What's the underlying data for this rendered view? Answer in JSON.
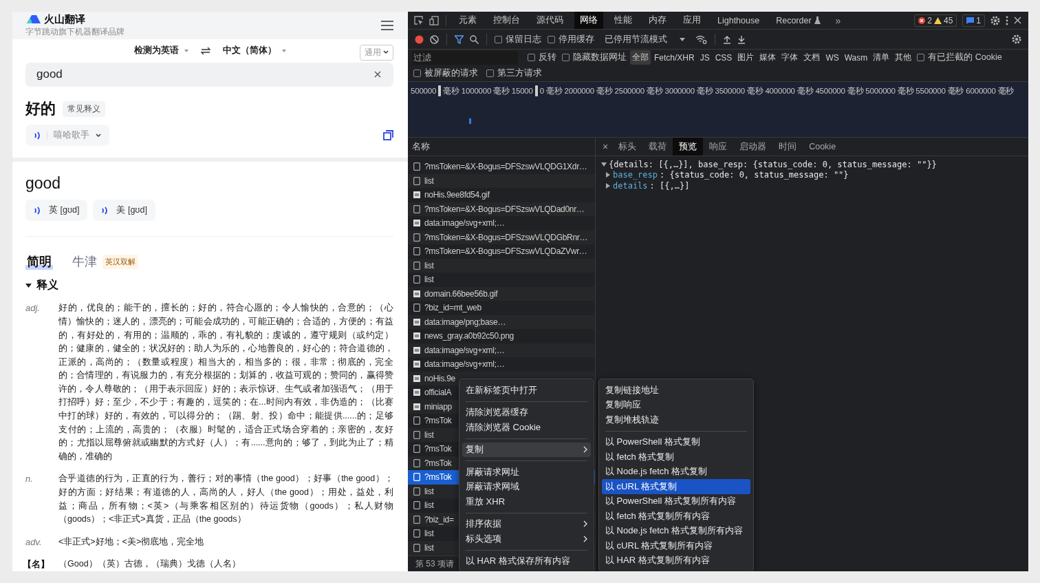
{
  "translator": {
    "logo_title": "火山翻译",
    "tagline": "字节跳动旗下机器翻译品牌",
    "source_lang": "检测为英语",
    "target_lang": "中文（简体）",
    "domain": "通用",
    "input_value": "good",
    "main_translation": "好的",
    "translation_tag": "常见释义",
    "voice": "嘻哈歌手",
    "word": "good",
    "pronunciations": [
      {
        "label": "英 [gʊd]"
      },
      {
        "label": "美 [gʊd]"
      }
    ],
    "dict_tabs": [
      {
        "label": "简明",
        "selected": true
      },
      {
        "label": "牛津",
        "selected": false,
        "badge": "英汉双解"
      }
    ],
    "section": {
      "title": "释义",
      "expanded": true
    },
    "definitions": [
      {
        "pos": "adj.",
        "kind": "pos",
        "text": "好的，优良的；能干的，擅长的；好的，符合心愿的；令人愉快的，合意的；（心情）愉快的；迷人的，漂亮的；可能会成功的，可能正确的；合适的，方便的；有益的，有好处的，有用的；温顺的，乖的，有礼貌的；虔诚的，遵守规则（或约定）的；健康的，健全的；状况好的；助人为乐的，心地善良的，好心的；符合道德的，正派的，高尚的；（数量或程度）相当大的，相当多的；很，非常；彻底的，完全的；合情理的，有说服力的，有充分根据的；划算的，收益可观的；赞同的，赢得赞许的，令人尊敬的；（用于表示回应）好的；表示惊讶、生气或者加强语气；（用于打招呼）好；至少，不少于；有趣的，逗笑的；在...时间内有效，非伪造的；（比赛中打的球）好的，有效的，可以得分的；（踢、射、投）命中；能提供......的；足够支付的；上流的，高贵的；（衣服）时髦的，适合正式场合穿着的；亲密的，友好的；尤指以屈尊俯就或幽默的方式好（人）；有......意向的；够了，到此为止了；精确的，准确的"
      },
      {
        "pos": "n.",
        "kind": "pos",
        "text": "合乎道德的行为，正直的行为，善行；对的事情（the good）；好事（the good）；好的方面；好结果；有道德的人，高尚的人，好人（the good）；用处，益处，利益；商品，所有物；<英>（与乘客相区别的）待运货物（goods）；私人财物（goods）；<非正式>真货，正品（the goods）"
      },
      {
        "pos": "adv.",
        "kind": "pos",
        "text": "<非正式>好地；<美>彻底地，完全地"
      },
      {
        "pos": "【名】",
        "kind": "name",
        "text": "（Good）（英）古德，（瑞典）戈德（人名）"
      }
    ]
  },
  "devtools": {
    "panel_tabs": [
      {
        "label": "元素",
        "selected": false,
        "kind": "plain"
      },
      {
        "label": "控制台",
        "selected": false,
        "kind": "plain"
      },
      {
        "label": "源代码",
        "selected": false,
        "kind": "plain"
      },
      {
        "label": "网络",
        "selected": true,
        "kind": "plain"
      },
      {
        "label": "性能",
        "selected": false,
        "kind": "plain"
      },
      {
        "label": "内存",
        "selected": false,
        "kind": "plain"
      },
      {
        "label": "应用",
        "selected": false,
        "kind": "plain"
      },
      {
        "label": "Lighthouse",
        "selected": false,
        "kind": "plain"
      },
      {
        "label": "Recorder",
        "selected": false,
        "kind": "experimental"
      }
    ],
    "more_tabs": "»",
    "errors": "2",
    "warnings": "45",
    "messages": "1",
    "toolbar": {
      "recording": true,
      "checkboxes": [
        {
          "label": "保留日志",
          "checked": false
        },
        {
          "label": "停用缓存",
          "checked": false
        }
      ],
      "throttling": "已停用节流模式"
    },
    "filter": {
      "placeholder": "过滤",
      "options": [
        {
          "label": "反转",
          "checked": false
        },
        {
          "label": "隐藏数据网址",
          "checked": false
        }
      ],
      "types": [
        {
          "label": "全部",
          "selected": true
        },
        {
          "label": "Fetch/XHR",
          "selected": false
        },
        {
          "label": "JS",
          "selected": false
        },
        {
          "label": "CSS",
          "selected": false
        },
        {
          "label": "图片",
          "selected": false
        },
        {
          "label": "媒体",
          "selected": false
        },
        {
          "label": "字体",
          "selected": false
        },
        {
          "label": "文档",
          "selected": false
        },
        {
          "label": "WS",
          "selected": false
        },
        {
          "label": "Wasm",
          "selected": false
        },
        {
          "label": "清单",
          "selected": false
        },
        {
          "label": "其他",
          "selected": false
        }
      ],
      "cookie_option": {
        "label": "有已拦截的 Cookie",
        "checked": false
      },
      "more_options": [
        {
          "label": "被屏蔽的请求",
          "checked": false
        },
        {
          "label": "第三方请求",
          "checked": false
        }
      ]
    },
    "overview": {
      "ticks": [
        {
          "text": "500000",
          "handle_after": true
        },
        {
          "text": "毫秒",
          "handle_after": false
        },
        {
          "text": "1000000 毫秒",
          "handle_after": false
        },
        {
          "text": "15000",
          "handle_after": true
        },
        {
          "text": "0 毫秒",
          "handle_after": false
        },
        {
          "text": "2000000 毫秒",
          "handle_after": false
        },
        {
          "text": "2500000 毫秒",
          "handle_after": false
        },
        {
          "text": "3000000 毫秒",
          "handle_after": false
        },
        {
          "text": "3500000 毫秒",
          "handle_after": false
        },
        {
          "text": "4000000 毫秒",
          "handle_after": false
        },
        {
          "text": "4500000 毫秒",
          "handle_after": false
        },
        {
          "text": "5000000 毫秒",
          "handle_after": false
        },
        {
          "text": "5500000 毫秒",
          "handle_after": false
        },
        {
          "text": "6000000 毫秒",
          "handle_after": false
        }
      ]
    },
    "requests": {
      "header": "名称",
      "status": "第 53 项请",
      "rows": [
        {
          "name": "?msToken=&X-Bogus=DFSzswVLQDG1Xdr…",
          "kind": "xhr",
          "selected": false
        },
        {
          "name": "list",
          "kind": "xhr",
          "selected": false
        },
        {
          "name": "noHis.9ee8fd54.gif",
          "kind": "image",
          "selected": false
        },
        {
          "name": "?msToken=&X-Bogus=DFSzswVLQDad0nr…",
          "kind": "xhr",
          "selected": false
        },
        {
          "name": "data:image/svg+xml;…",
          "kind": "image",
          "selected": false
        },
        {
          "name": "?msToken=&X-Bogus=DFSzswVLQDGbRnr…",
          "kind": "xhr",
          "selected": false
        },
        {
          "name": "?msToken=&X-Bogus=DFSzswVLQDaZVwr…",
          "kind": "xhr",
          "selected": false
        },
        {
          "name": "list",
          "kind": "xhr",
          "selected": false
        },
        {
          "name": "list",
          "kind": "xhr",
          "selected": false
        },
        {
          "name": "domain.66bee56b.gif",
          "kind": "image",
          "selected": false
        },
        {
          "name": "?biz_id=mt_web",
          "kind": "xhr",
          "selected": false
        },
        {
          "name": "data:image/png;base…",
          "kind": "image",
          "selected": false
        },
        {
          "name": "news_gray.a0b92c50.png",
          "kind": "image",
          "selected": false
        },
        {
          "name": "data:image/svg+xml;…",
          "kind": "image",
          "selected": false
        },
        {
          "name": "data:image/svg+xml;…",
          "kind": "image",
          "selected": false
        },
        {
          "name": "noHis.9e",
          "kind": "image",
          "selected": false
        },
        {
          "name": "officialA",
          "kind": "image",
          "selected": false
        },
        {
          "name": "miniapp",
          "kind": "image",
          "selected": false
        },
        {
          "name": "?msTok",
          "kind": "xhr",
          "selected": false
        },
        {
          "name": "list",
          "kind": "xhr",
          "selected": false
        },
        {
          "name": "?msTok",
          "kind": "xhr",
          "selected": false
        },
        {
          "name": "?msTok",
          "kind": "xhr",
          "selected": false
        },
        {
          "name": "?msTok",
          "kind": "xhr",
          "selected": true
        },
        {
          "name": "list",
          "kind": "xhr",
          "selected": false
        },
        {
          "name": "list",
          "kind": "xhr",
          "selected": false
        },
        {
          "name": "?biz_id=",
          "kind": "xhr",
          "selected": false
        },
        {
          "name": "list",
          "kind": "xhr",
          "selected": false
        },
        {
          "name": "list",
          "kind": "xhr",
          "selected": false
        }
      ]
    },
    "detail": {
      "close": "×",
      "tabs": [
        {
          "label": "标头",
          "selected": false
        },
        {
          "label": "载荷",
          "selected": false
        },
        {
          "label": "预览",
          "selected": true
        },
        {
          "label": "响应",
          "selected": false
        },
        {
          "label": "启动器",
          "selected": false
        },
        {
          "label": "时间",
          "selected": false
        },
        {
          "label": "Cookie",
          "selected": false
        }
      ],
      "preview": {
        "summary": "{details: [{,…}], base_resp: {status_code: 0, status_message: \"\"}}",
        "expanded": true,
        "children": [
          {
            "key": "base_resp",
            "value": ": {status_code: 0, status_message: \"\"}",
            "expanded": false
          },
          {
            "key": "details",
            "value": ": [{,…}]",
            "expanded": false
          }
        ]
      }
    },
    "context_menu": {
      "groups": [
        [
          {
            "label": "在新标签页中打开",
            "selected": false,
            "submenu": false
          }
        ],
        [
          {
            "label": "清除浏览器缓存",
            "selected": false,
            "submenu": false
          },
          {
            "label": "清除浏览器 Cookie",
            "selected": false,
            "submenu": false
          }
        ],
        [
          {
            "label": "复制",
            "selected": true,
            "submenu": true
          }
        ],
        [
          {
            "label": "屏蔽请求网址",
            "selected": false,
            "submenu": false
          },
          {
            "label": "屏蔽请求网域",
            "selected": false,
            "submenu": false
          },
          {
            "label": "重放 XHR",
            "selected": false,
            "submenu": false
          }
        ],
        [
          {
            "label": "排序依据",
            "selected": false,
            "submenu": true
          },
          {
            "label": "标头选项",
            "selected": false,
            "submenu": true
          }
        ],
        [
          {
            "label": "以 HAR 格式保存所有内容",
            "selected": false,
            "submenu": false
          }
        ]
      ]
    },
    "submenu": {
      "groups": [
        [
          {
            "label": "复制链接地址",
            "selected": false
          },
          {
            "label": "复制响应",
            "selected": false
          },
          {
            "label": "复制堆栈轨迹",
            "selected": false
          }
        ],
        [
          {
            "label": "以 PowerShell 格式复制",
            "selected": false
          },
          {
            "label": "以 fetch 格式复制",
            "selected": false
          },
          {
            "label": "以 Node.js fetch 格式复制",
            "selected": false
          },
          {
            "label": "以 cURL 格式复制",
            "selected": true
          },
          {
            "label": "以 PowerShell 格式复制所有内容",
            "selected": false
          },
          {
            "label": "以 fetch 格式复制所有内容",
            "selected": false
          },
          {
            "label": "以 Node.js fetch 格式复制所有内容",
            "selected": false
          },
          {
            "label": "以 cURL 格式复制所有内容",
            "selected": false
          },
          {
            "label": "以 HAR 格式复制所有内容",
            "selected": false
          }
        ]
      ]
    }
  }
}
